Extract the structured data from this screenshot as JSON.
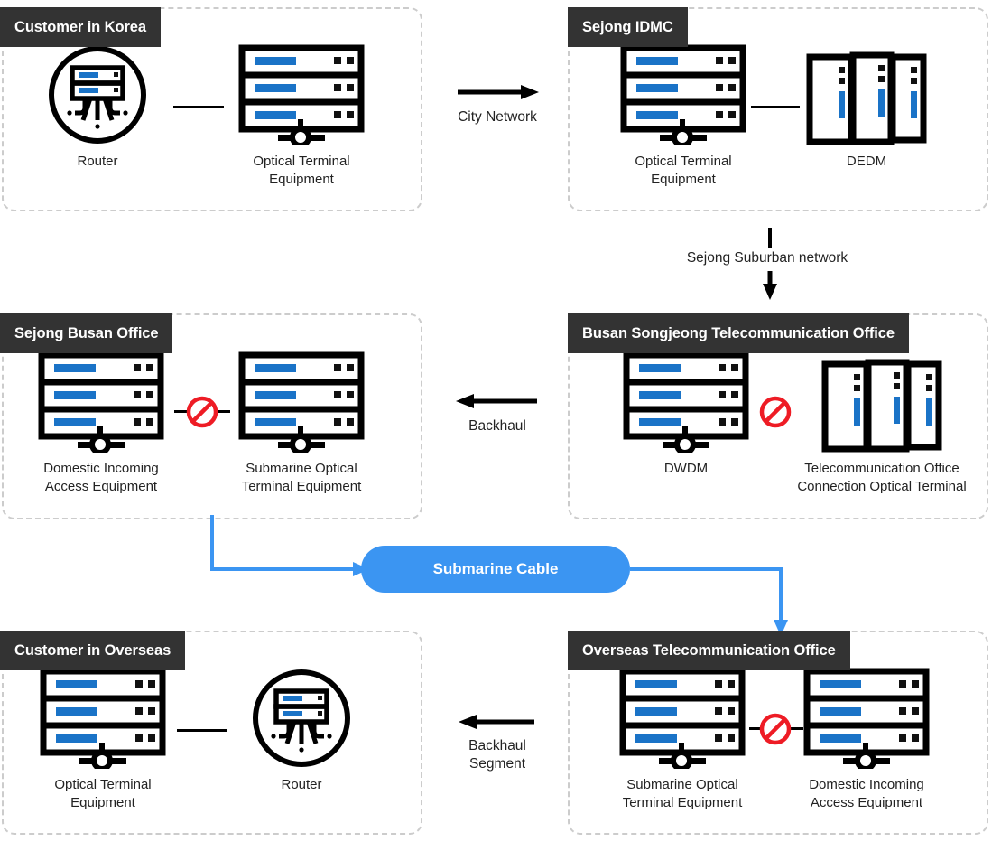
{
  "diagram": {
    "title": "Submarine cable network connectivity diagram",
    "colors": {
      "accent_blue": "#3b95f2",
      "device_blue": "#1a73c7",
      "header_dark": "#333333",
      "panel_border": "#cccccc",
      "block_red": "#ee1c25",
      "line_black": "#000000"
    }
  },
  "panels": [
    {
      "id": "customer-korea",
      "title": "Customer in Korea",
      "devices": [
        {
          "id": "router-kr",
          "icon": "router-circle-icon",
          "caption": "Router"
        },
        {
          "id": "ote-kr",
          "icon": "server-rack-icon",
          "caption": "Optical Terminal\nEquipment"
        }
      ],
      "inner_connector": {
        "type": "plain-line"
      }
    },
    {
      "id": "sejong-idmc",
      "title": "Sejong IDMC",
      "devices": [
        {
          "id": "ote-idmc",
          "icon": "server-rack-icon",
          "caption": "Optical Terminal\nEquipment"
        },
        {
          "id": "dedm",
          "icon": "cabinet-trio-icon",
          "caption": "DEDM"
        }
      ],
      "inner_connector": {
        "type": "plain-line"
      }
    },
    {
      "id": "sejong-busan-office",
      "title": "Sejong Busan Office",
      "devices": [
        {
          "id": "domestic-incoming-kr",
          "icon": "server-rack-icon",
          "caption": "Domestic Incoming\nAccess Equipment"
        },
        {
          "id": "submarine-ote-kr",
          "icon": "server-rack-icon",
          "caption": "Submarine Optical\nTerminal Equipment"
        }
      ],
      "inner_connector": {
        "type": "blocked-line",
        "marker": "no-entry-icon"
      }
    },
    {
      "id": "busan-songjeong",
      "title": "Busan Songjeong Telecommunication Office",
      "devices": [
        {
          "id": "dwdm",
          "icon": "server-rack-icon",
          "caption": "DWDM"
        },
        {
          "id": "tel-office-conn",
          "icon": "cabinet-trio-icon",
          "caption": "Telecommunication Office\nConnection Optical Terminal"
        }
      ],
      "inner_connector": {
        "type": "blocked-marker-only",
        "marker": "no-entry-icon"
      }
    },
    {
      "id": "customer-overseas",
      "title": "Customer in Overseas",
      "devices": [
        {
          "id": "ote-overseas",
          "icon": "server-rack-icon",
          "caption": "Optical Terminal\nEquipment"
        },
        {
          "id": "router-overseas",
          "icon": "router-circle-icon",
          "caption": "Router"
        }
      ],
      "inner_connector": {
        "type": "plain-line"
      }
    },
    {
      "id": "overseas-tel-office",
      "title": "Overseas Telecommunication Office",
      "devices": [
        {
          "id": "submarine-ote-os",
          "icon": "server-rack-icon",
          "caption": "Submarine Optical\nTerminal Equipment"
        },
        {
          "id": "domestic-incoming-os",
          "icon": "server-rack-icon",
          "caption": "Domestic Incoming\nAccess Equipment"
        }
      ],
      "inner_connector": {
        "type": "blocked-line",
        "marker": "no-entry-icon"
      }
    }
  ],
  "connectors": [
    {
      "id": "city-network",
      "label": "City Network",
      "direction": "right",
      "from": "customer-korea",
      "to": "sejong-idmc"
    },
    {
      "id": "sejong-suburban",
      "label": "Sejong Suburban network",
      "direction": "down",
      "from": "sejong-idmc",
      "to": "busan-songjeong"
    },
    {
      "id": "backhaul",
      "label": "Backhaul",
      "direction": "left",
      "from": "busan-songjeong",
      "to": "sejong-busan-office"
    },
    {
      "id": "backhaul-segment",
      "label": "Backhaul\nSegment",
      "direction": "left",
      "from": "overseas-tel-office",
      "to": "customer-overseas"
    }
  ],
  "cable": {
    "id": "submarine-cable",
    "label": "Submarine Cable",
    "inbound_from": "sejong-busan-office",
    "outbound_to": "overseas-tel-office"
  }
}
